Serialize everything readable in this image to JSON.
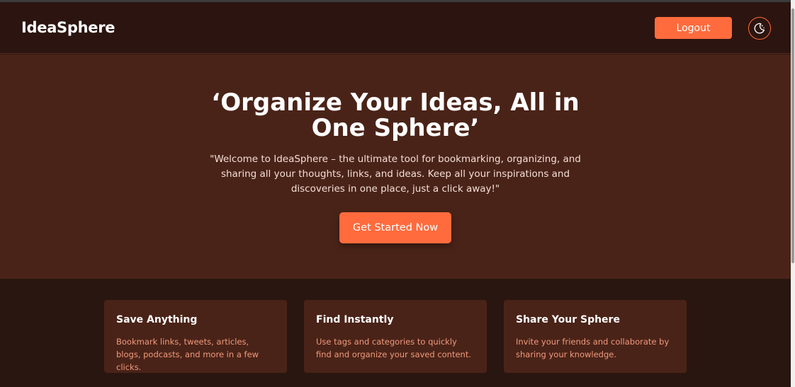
{
  "colors": {
    "accent": "#ff6b3d",
    "nav_bg": "#2c1510",
    "hero_bg": "#4a2318",
    "page_bg": "#2a1610",
    "card_bg": "#4a2318",
    "card_text": "#f09a7c"
  },
  "navbar": {
    "brand": "IdeaSphere",
    "logout_label": "Logout",
    "theme_toggle_icon": "moon-stars-icon"
  },
  "hero": {
    "title_line1": "‘Organize Your Ideas, All in",
    "title_line2": "One Sphere’",
    "description": "\"Welcome to IdeaSphere – the ultimate tool for bookmarking, organizing, and sharing all your thoughts, links, and ideas. Keep all your inspirations and discoveries in one place, just a click away!\"",
    "cta_label": "Get Started Now"
  },
  "features": [
    {
      "title": "Save Anything",
      "text": "Bookmark links, tweets, articles, blogs, podcasts, and more in a few clicks."
    },
    {
      "title": "Find Instantly",
      "text": "Use tags and categories to quickly find and organize your saved content."
    },
    {
      "title": "Share Your Sphere",
      "text": "Invite your friends and collaborate by sharing your knowledge."
    }
  ]
}
